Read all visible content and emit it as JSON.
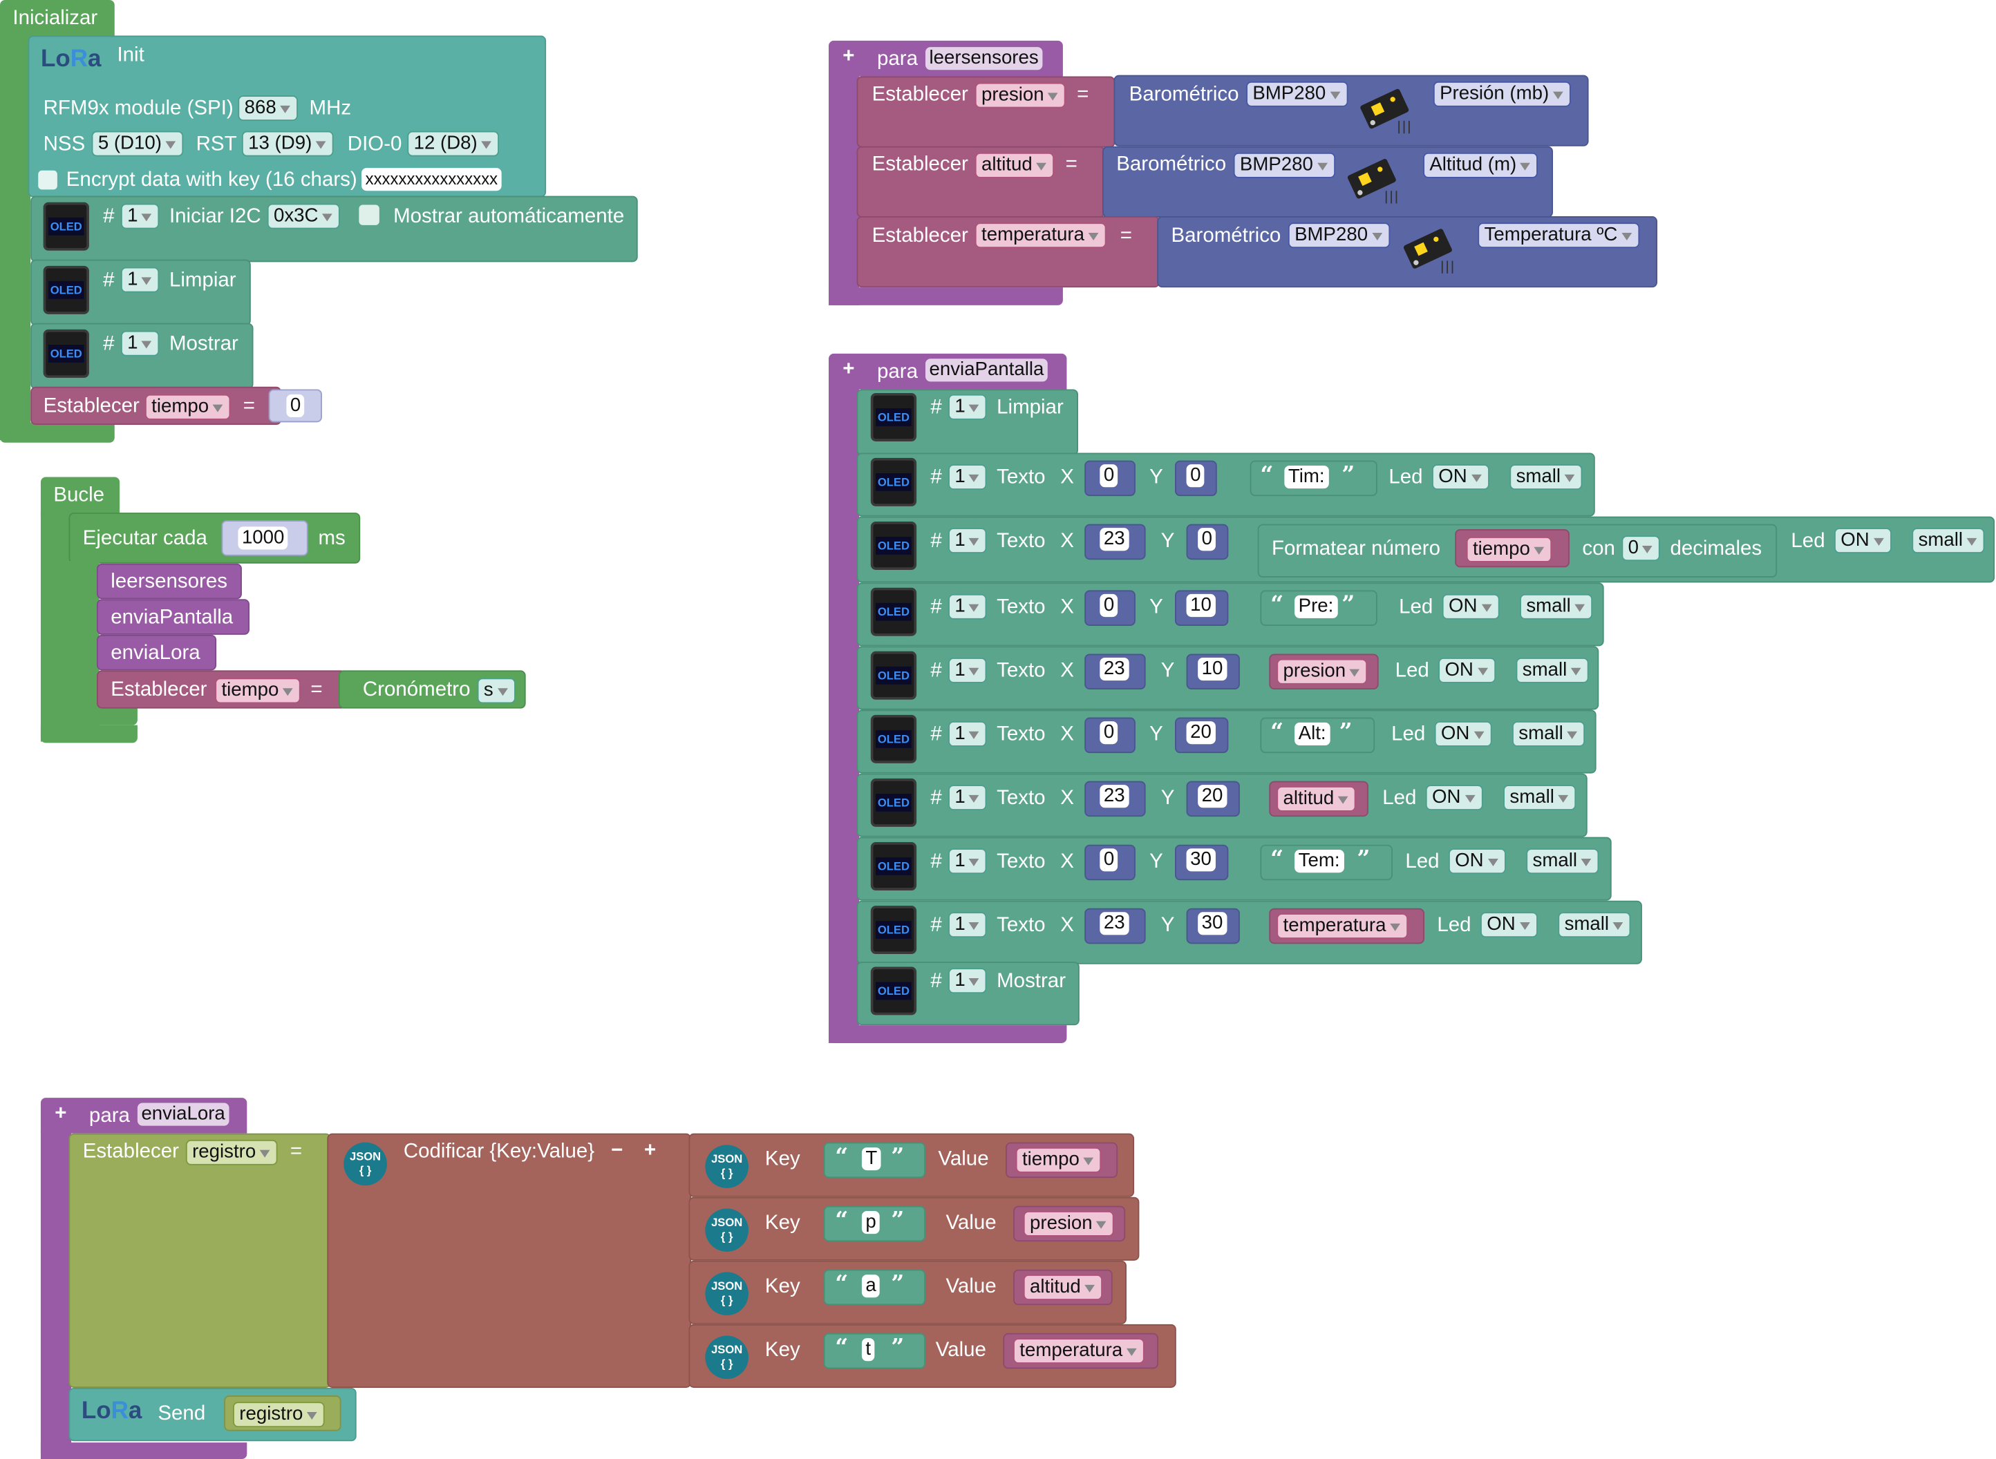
{
  "colors": {
    "loop": "#5ba55b",
    "proc": "#995ba5",
    "var": "#a55b80",
    "math": "#5b67a5",
    "oled": "#5ba58c",
    "text": "#5ba58c",
    "json": "#a5645b",
    "lora": "#5ba5a5",
    "bar": "#5b80a5"
  },
  "init": {
    "hat": "Inicializar",
    "lora_title": "Init",
    "rfm": "RFM9x module (SPI)",
    "freq": "868",
    "mhz": "MHz",
    "nss": "NSS",
    "nss_val": "5 (D10)",
    "rst": "RST",
    "rst_val": "13 (D9)",
    "dio": "DIO-0",
    "dio_val": "12 (D8)",
    "encrypt": "Encrypt data with key (16 chars)",
    "key": "xxxxxxxxxxxxxxxx",
    "oled1_hash": "#",
    "oled1_num": "1",
    "oled1_text": "Iniciar I2C",
    "oled1_addr": "0x3C",
    "oled1_auto": "Mostrar automáticamente",
    "oled2_hash": "#",
    "oled2_num": "1",
    "oled2_text": "Limpiar",
    "oled3_hash": "#",
    "oled3_num": "1",
    "oled3_text": "Mostrar",
    "set_label": "Establecer",
    "set_var": "tiempo",
    "set_eq": "=",
    "set_val": "0"
  },
  "loop": {
    "hat": "Bucle",
    "every": "Ejecutar cada",
    "every_val": "1000",
    "ms": "ms",
    "call1": "leersensores",
    "call2": "enviaPantalla",
    "call3": "enviaLora",
    "set_label": "Establecer",
    "set_var": "tiempo",
    "set_eq": "=",
    "timer": "Cronómetro",
    "timer_unit": "s"
  },
  "leersensores": {
    "plus": "+",
    "para": "para",
    "name": "leersensores",
    "rows": [
      {
        "set": "Establecer",
        "var": "presion",
        "eq": "=",
        "baro": "Barométrico",
        "sensor": "BMP280",
        "meas": "Presión (mb)"
      },
      {
        "set": "Establecer",
        "var": "altitud",
        "eq": "=",
        "baro": "Barométrico",
        "sensor": "BMP280",
        "meas": "Altitud (m)"
      },
      {
        "set": "Establecer",
        "var": "temperatura",
        "eq": "=",
        "baro": "Barométrico",
        "sensor": "BMP280",
        "meas": "Temperatura ºC"
      }
    ]
  },
  "enviaPantalla": {
    "plus": "+",
    "para": "para",
    "name": "enviaPantalla",
    "clear": {
      "hash": "#",
      "num": "1",
      "text": "Limpiar"
    },
    "rows": [
      {
        "hash": "#",
        "num": "1",
        "texto": "Texto",
        "x": "X",
        "xv": "0",
        "y": "Y",
        "yv": "0",
        "str": "Tim:",
        "led": "Led",
        "on": "ON",
        "size": "small"
      },
      {
        "hash": "#",
        "num": "1",
        "texto": "Texto",
        "x": "X",
        "xv": "23",
        "y": "Y",
        "yv": "0",
        "fmt": "Formatear número",
        "var": "tiempo",
        "con": "con",
        "dec": "0",
        "decimales": "decimales",
        "led": "Led",
        "on": "ON",
        "size": "small"
      },
      {
        "hash": "#",
        "num": "1",
        "texto": "Texto",
        "x": "X",
        "xv": "0",
        "y": "Y",
        "yv": "10",
        "str": "Pre:",
        "led": "Led",
        "on": "ON",
        "size": "small"
      },
      {
        "hash": "#",
        "num": "1",
        "texto": "Texto",
        "x": "X",
        "xv": "23",
        "y": "Y",
        "yv": "10",
        "var": "presion",
        "led": "Led",
        "on": "ON",
        "size": "small"
      },
      {
        "hash": "#",
        "num": "1",
        "texto": "Texto",
        "x": "X",
        "xv": "0",
        "y": "Y",
        "yv": "20",
        "str": "Alt:",
        "led": "Led",
        "on": "ON",
        "size": "small"
      },
      {
        "hash": "#",
        "num": "1",
        "texto": "Texto",
        "x": "X",
        "xv": "23",
        "y": "Y",
        "yv": "20",
        "var": "altitud",
        "led": "Led",
        "on": "ON",
        "size": "small"
      },
      {
        "hash": "#",
        "num": "1",
        "texto": "Texto",
        "x": "X",
        "xv": "0",
        "y": "Y",
        "yv": "30",
        "str": "Tem:",
        "led": "Led",
        "on": "ON",
        "size": "small"
      },
      {
        "hash": "#",
        "num": "1",
        "texto": "Texto",
        "x": "X",
        "xv": "23",
        "y": "Y",
        "yv": "30",
        "var": "temperatura",
        "led": "Led",
        "on": "ON",
        "size": "small"
      }
    ],
    "show": {
      "hash": "#",
      "num": "1",
      "text": "Mostrar"
    }
  },
  "enviaLora": {
    "plus": "+",
    "para": "para",
    "name": "enviaLora",
    "set": "Establecer",
    "var": "registro",
    "eq": "=",
    "json_icon": "JSON",
    "encode": "Codificar {Key:Value}",
    "minus": "−",
    "plus2": "+",
    "pairs": [
      {
        "key": "Key",
        "k": "T",
        "value": "Value",
        "v": "tiempo"
      },
      {
        "key": "Key",
        "k": "p",
        "value": "Value",
        "v": "presion"
      },
      {
        "key": "Key",
        "k": "a",
        "value": "Value",
        "v": "altitud"
      },
      {
        "key": "Key",
        "k": "t",
        "value": "Value",
        "v": "temperatura"
      }
    ],
    "send": "Send",
    "send_var": "registro"
  }
}
